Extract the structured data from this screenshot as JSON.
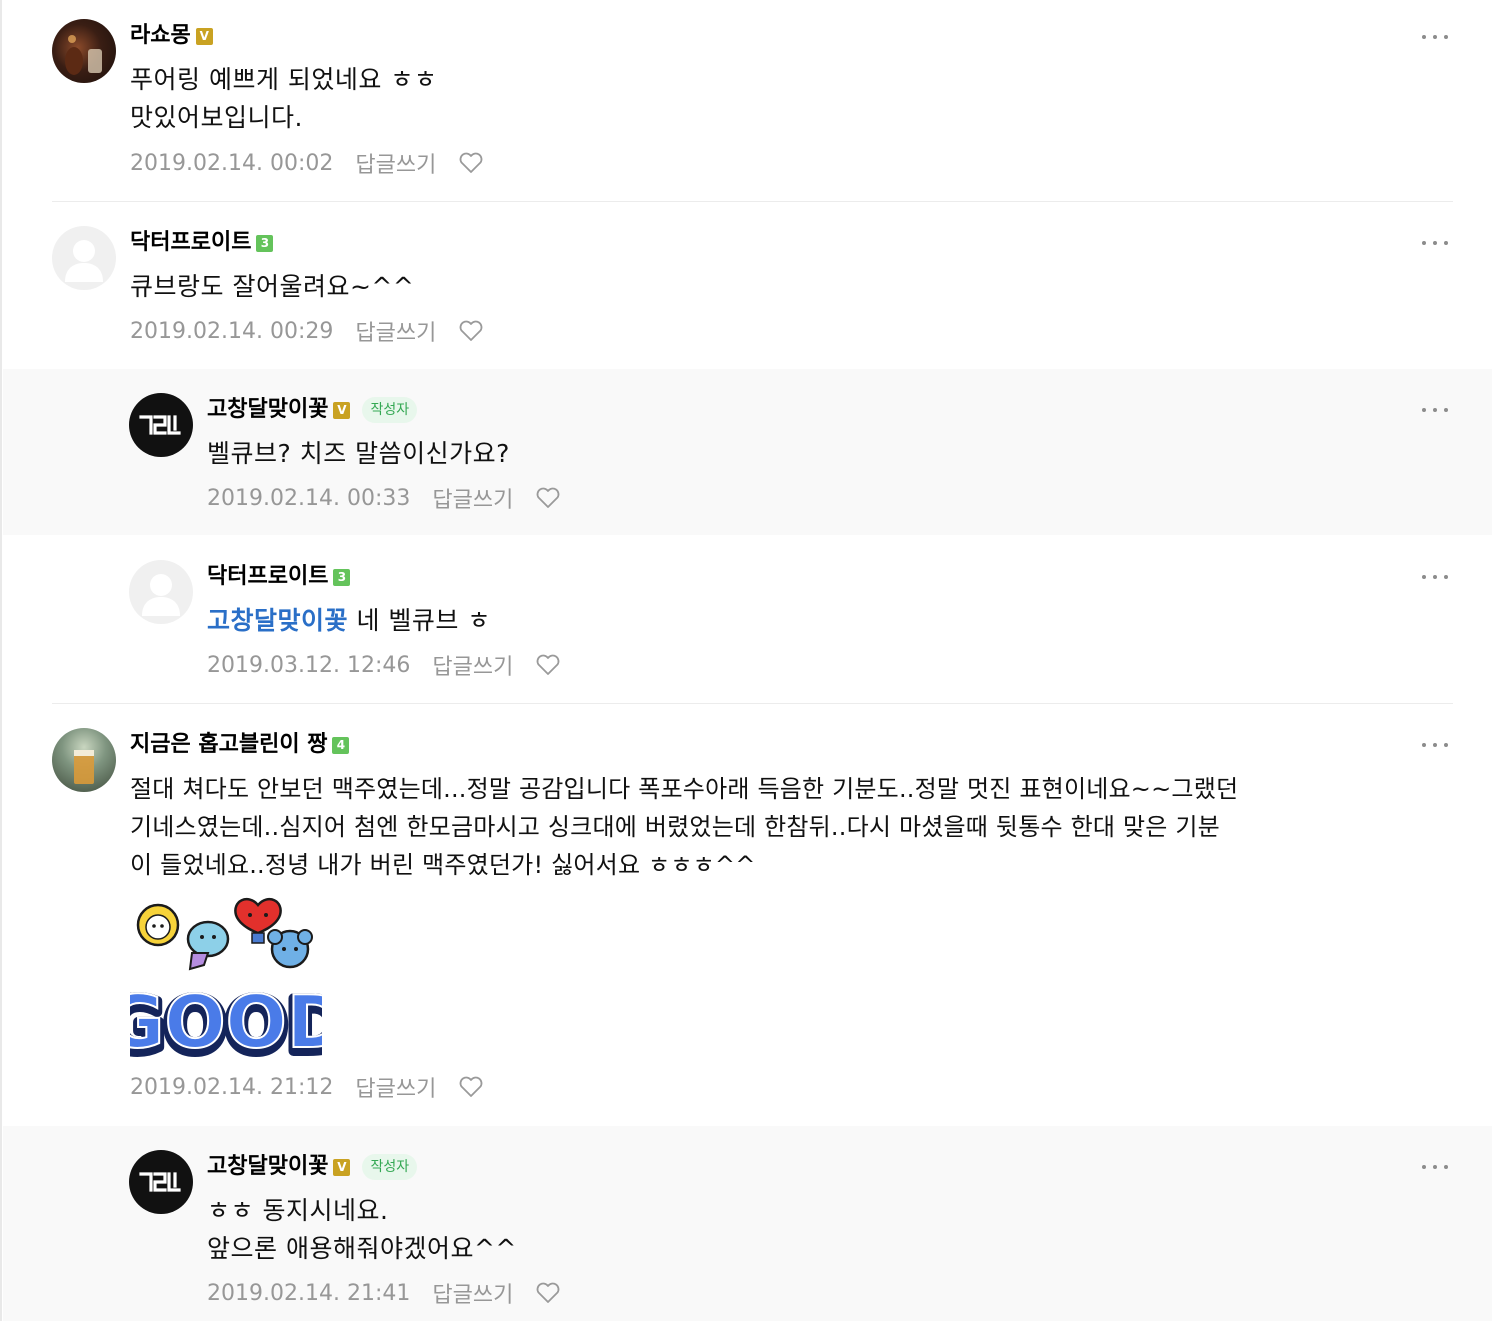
{
  "comments": [
    {
      "nickname": "라쇼몽",
      "badge": "V",
      "lines": [
        "푸어링 예쁘게 되었네요 ㅎㅎ",
        "맛있어보입니다."
      ],
      "date": "2019.02.14. 00:02",
      "reply_label": "답글쓰기"
    },
    {
      "nickname": "닥터프로이트",
      "badge": "3",
      "lines": [
        "큐브랑도 잘어울려요~^^"
      ],
      "date": "2019.02.14. 00:29",
      "reply_label": "답글쓰기"
    },
    {
      "nickname": "고창달맞이꽃",
      "badge": "V",
      "writer_tag": "작성자",
      "lines": [
        "벨큐브? 치즈 말씀이신가요?"
      ],
      "date": "2019.02.14. 00:33",
      "reply_label": "답글쓰기"
    },
    {
      "nickname": "닥터프로이트",
      "badge": "3",
      "mention": "고창달맞이꽃",
      "lines": [
        " 네 벨큐브 ㅎ"
      ],
      "date": "2019.03.12. 12:46",
      "reply_label": "답글쓰기"
    },
    {
      "nickname": "지금은 홉고블린이 짱",
      "badge": "4",
      "lines": [
        "절대 쳐다도 안보던 맥주였는데...정말 공감입니다 폭포수아래 득음한 기분도..정말 멋진 표현이네요~~그랬던",
        "기네스였는데..심지어 첨엔 한모금마시고 싱크대에 버렸었는데 한참뒤..다시 마셨을때 뒷통수 한대 맞은 기분",
        "이 들었네요..정녕 내가 버린 맥주였던가! 싫어서요 ㅎㅎㅎ^^"
      ],
      "sticker_text": "GOOD",
      "date": "2019.02.14. 21:12",
      "reply_label": "답글쓰기"
    },
    {
      "nickname": "고창달맞이꽃",
      "badge": "V",
      "writer_tag": "작성자",
      "lines": [
        "ㅎㅎ 동지시네요.",
        "앞으론 애용해줘야겠어요^^"
      ],
      "date": "2019.02.14. 21:41",
      "reply_label": "답글쓰기"
    }
  ],
  "colors": {
    "writer_tag_bg": "#e8f7ec",
    "writer_tag_text": "#34a853",
    "mention": "#2a6fc7",
    "badge_v": "#c9a222",
    "badge_level": "#64c35b",
    "meta": "#979797",
    "reply_bg": "#f9f9f9"
  },
  "icons": [
    "more-options-icon",
    "heart-icon",
    "default-profile-icon",
    "logo-avatar"
  ]
}
